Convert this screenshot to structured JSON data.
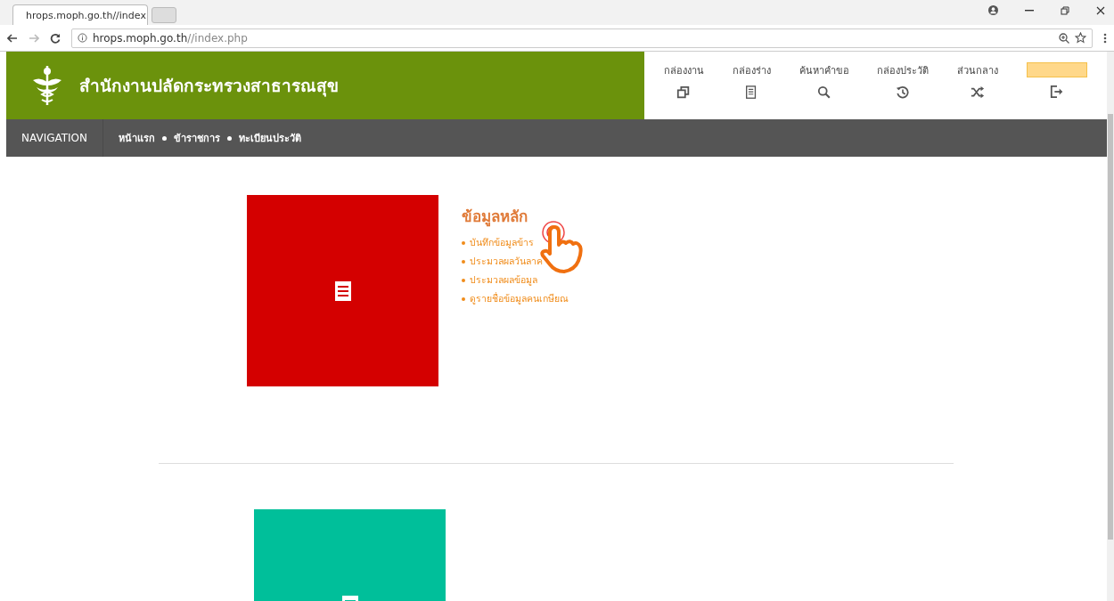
{
  "browser": {
    "tab_title": "hrops.moph.go.th//index",
    "url_host": "hrops.moph.go.th",
    "url_path": "//index.php"
  },
  "header": {
    "title": "สำนักงานปลัดกระทรวงสาธารณสุข",
    "menu": [
      {
        "label": "กล่องงาน"
      },
      {
        "label": "กล่องร่าง"
      },
      {
        "label": "ค้นหาคำขอ"
      },
      {
        "label": "กล่องประวัติ"
      },
      {
        "label": "ส่วนกลาง"
      },
      {
        "kind": "user"
      }
    ]
  },
  "navigation": {
    "label": "NAVIGATION",
    "breadcrumbs": [
      "หน้าแรก",
      "ข้าราชการ",
      "ทะเบียนประวัติ"
    ]
  },
  "sections": [
    {
      "color": "#d40000",
      "heading": "ข้อมูลหลัก",
      "links": [
        "บันทึกข้อมูลข้าร",
        "ประมวลผลวันลาค",
        "ประมวลผลข้อมูล",
        "ดูรายชื่อข้อมูลคนเกษียณ"
      ]
    },
    {
      "color": "#00bf9a"
    }
  ]
}
